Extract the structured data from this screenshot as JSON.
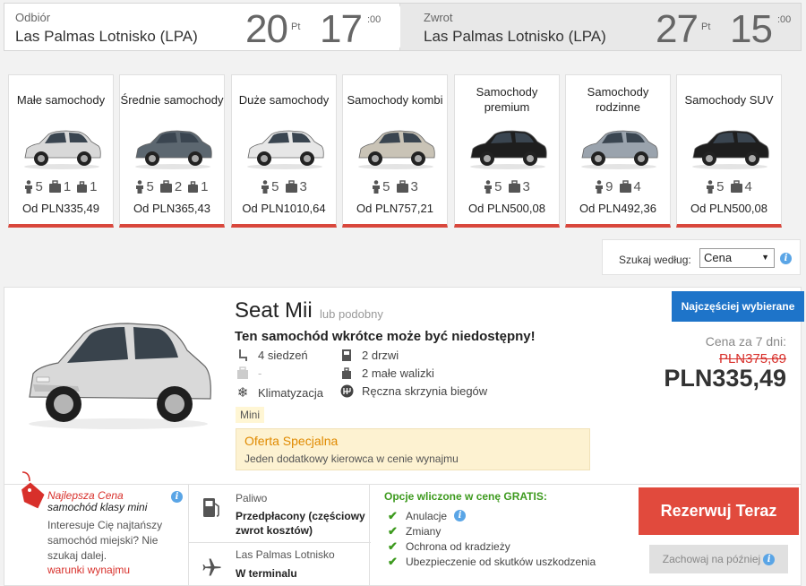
{
  "pickup": {
    "label": "Odbiór",
    "location": "Las Palmas Lotnisko (LPA)",
    "day": "20",
    "dow": "Pt",
    "hour": "17",
    "minutes": ":00"
  },
  "dropoff": {
    "label": "Zwrot",
    "location": "Las Palmas Lotnisko (LPA)",
    "day": "27",
    "dow": "Pt",
    "hour": "15",
    "minutes": ":00"
  },
  "categories": [
    {
      "title": "Małe samochody",
      "seats": "5",
      "bags": "1",
      "small_bags": "1",
      "price": "Od PLN335,49",
      "color": "#d8d8d8"
    },
    {
      "title": "Średnie samochody",
      "seats": "5",
      "bags": "2",
      "small_bags": "1",
      "price": "Od PLN365,43",
      "color": "#5c6770"
    },
    {
      "title": "Duże samochody",
      "seats": "5",
      "bags": "3",
      "price": "Od PLN1010,64",
      "color": "#e6e6e6"
    },
    {
      "title": "Samochody kombi",
      "seats": "5",
      "bags": "3",
      "price": "Od PLN757,21",
      "color": "#c9c3b6"
    },
    {
      "title": "Samochody premium",
      "seats": "5",
      "bags": "3",
      "price": "Od PLN500,08",
      "color": "#1e1e1e"
    },
    {
      "title": "Samochody rodzinne",
      "seats": "9",
      "bags": "4",
      "price": "Od PLN492,36",
      "color": "#9aa3ad"
    },
    {
      "title": "Samochody SUV",
      "seats": "5",
      "bags": "4",
      "price": "Od PLN500,08",
      "color": "#1e1e1e"
    }
  ],
  "sort": {
    "label": "Szukaj według:",
    "value": "Cena"
  },
  "result": {
    "name": "Seat Mii",
    "similar": "lub podobny",
    "badge": "Najczęściej wybierane",
    "warning": "Ten samochód wkrótce może być niedostępny!",
    "seats": "4 siedzeń",
    "doors": "2 drzwi",
    "bags": "-",
    "small_bags": "2 małe walizki",
    "ac": "Klimatyzacja",
    "gearbox": "Ręczna skrzynia biegów",
    "class_tag": "Mini",
    "offer_title": "Oferta Specjalna",
    "offer_text": "Jeden dodatkowy kierowca w cenie wynajmu",
    "price_label": "Cena za 7 dni:",
    "price_old": "PLN375,69",
    "price_new": "PLN335,49",
    "car_color": "#d9d9d9"
  },
  "deal": {
    "title_best": "Najlepsza",
    "title_price": "Cena",
    "title_rest": "samochód klasy mini",
    "text": "Interesuje Cię najtańszy samochód miejski? Nie szukaj dalej.",
    "link": "warunki wynajmu"
  },
  "fuel": {
    "label": "Paliwo",
    "value": "Przedpłacony (częściowy zwrot kosztów)"
  },
  "location": {
    "label": "Las Palmas Lotnisko",
    "value": "W terminalu"
  },
  "included": {
    "title": "Opcje wliczone w cenę GRATIS:",
    "items": [
      "Anulacje",
      "Zmiany",
      "Ochrona od kradzieży",
      "Ubezpieczenie od skutków uszkodzenia"
    ]
  },
  "actions": {
    "book": "Rezerwuj Teraz",
    "save": "Zachowaj na później"
  },
  "colors": {
    "accent_red": "#e14a3d",
    "badge_blue": "#1e74c9",
    "green": "#3d9a1e",
    "offer_orange": "#e08a00"
  }
}
